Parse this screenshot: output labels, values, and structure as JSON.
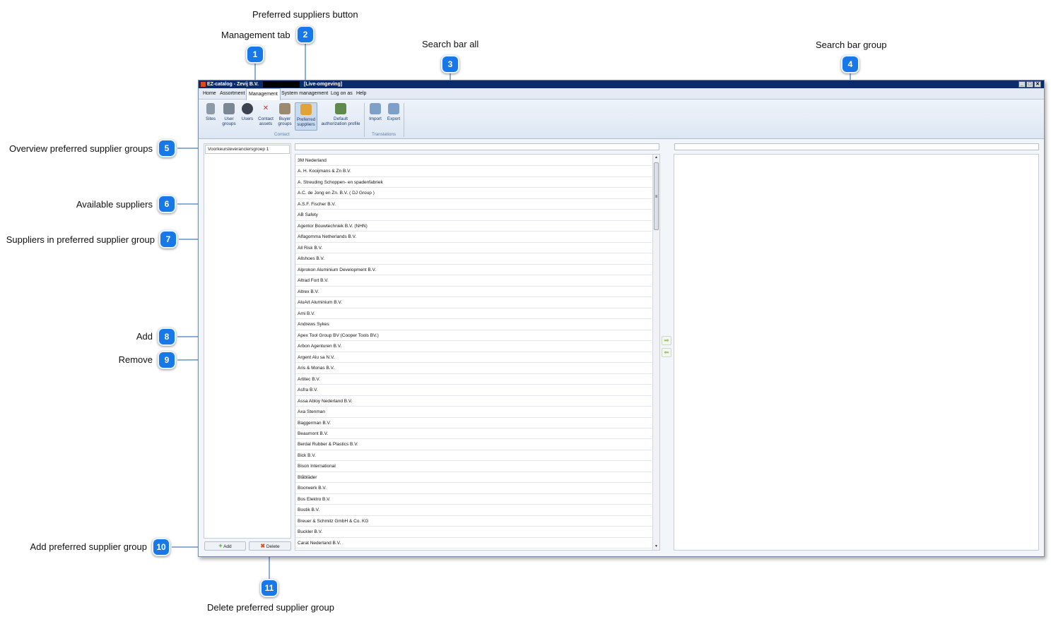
{
  "callouts": [
    {
      "num": "1",
      "label": "Management tab"
    },
    {
      "num": "2",
      "label": "Preferred suppliers button"
    },
    {
      "num": "3",
      "label": "Search bar all"
    },
    {
      "num": "4",
      "label": "Search bar group"
    },
    {
      "num": "5",
      "label": "Overview preferred supplier groups"
    },
    {
      "num": "6",
      "label": "Available suppliers"
    },
    {
      "num": "7",
      "label": "Suppliers in preferred supplier group"
    },
    {
      "num": "8",
      "label": "Add"
    },
    {
      "num": "9",
      "label": "Remove"
    },
    {
      "num": "10",
      "label": "Add preferred supplier group"
    },
    {
      "num": "11",
      "label": "Delete preferred supplier group"
    }
  ],
  "window": {
    "title": "EZ-catalog - Zevij B.V.",
    "environment": "[Live-omgeving]",
    "controls": [
      "_",
      "□",
      "✕"
    ]
  },
  "menu": [
    "Home",
    "Assortment",
    "Management",
    "System management",
    "Log on as",
    "Help"
  ],
  "ribbon": {
    "contact_buttons": [
      {
        "line1": "Sites",
        "line2": ""
      },
      {
        "line1": "User",
        "line2": "groups"
      },
      {
        "line1": "Users",
        "line2": ""
      },
      {
        "line1": "Contact",
        "line2": "assets"
      },
      {
        "line1": "Buyer",
        "line2": "groups"
      },
      {
        "line1": "Preferred",
        "line2": "suppliers"
      },
      {
        "line1": "Default",
        "line2": "authorization profile"
      }
    ],
    "contact_group_label": "Contact",
    "translation_buttons": [
      {
        "line1": "Import",
        "line2": ""
      },
      {
        "line1": "Export",
        "line2": ""
      }
    ],
    "translations_group_label": "Translations"
  },
  "groups": [
    "Voorkeursleveranciersgroep 1"
  ],
  "suppliers": [
    "3M Nederland",
    "A. H. Kooijmans & Zn B.V.",
    "A. Streuding Schoppen- en spadenfabriek",
    "A.C. de Jong en Zn. B.V. ( DJ Group )",
    "A.S.F. Fischer B.V.",
    "AB Safety",
    "Agentor Bouwtechniek B.V. (NHN)",
    "Alfagomma Netherlands B.V.",
    "All Risk B.V.",
    "Allshoes B.V.",
    "Alprokon Aluminium Development B.V.",
    "Altrad Fort B.V.",
    "Altrex B.V.",
    "AluArt Aluminium B.V.",
    "Ami B.V.",
    "Andrews Sykes",
    "Apex Tool Group BV (Cooper Tools BV.)",
    "Arbon Agenturen B.V.",
    "Argent Alu sa N.V.",
    "Aris & Monas B.V.",
    "Artitec B.V.",
    "Asfra B.V.",
    "Assa Abloy Nederland B.V.",
    "Axa Stenman",
    "Baggerman B.V.",
    "Beaumont B.V.",
    "Berdal Rubber & Plastics B.V.",
    "Bick B.V.",
    "Bison International",
    "Blåbläder",
    "Boorwerk B.V.",
    "Bos Elektro B.V.",
    "Bostik B.V.",
    "Breuer & Schmitz GmbH & Co. KG",
    "Buckler B.V.",
    "Carat Nederland B.V."
  ],
  "buttons": {
    "add_label": "Add",
    "delete_label": "Delete",
    "move_add_icon": "arrow-right-icon",
    "move_remove_icon": "arrow-left-icon"
  },
  "colors": {
    "badge": "#1878e8",
    "titlebar": "#0a2a6a",
    "leader_line": "#1a5fb4"
  }
}
